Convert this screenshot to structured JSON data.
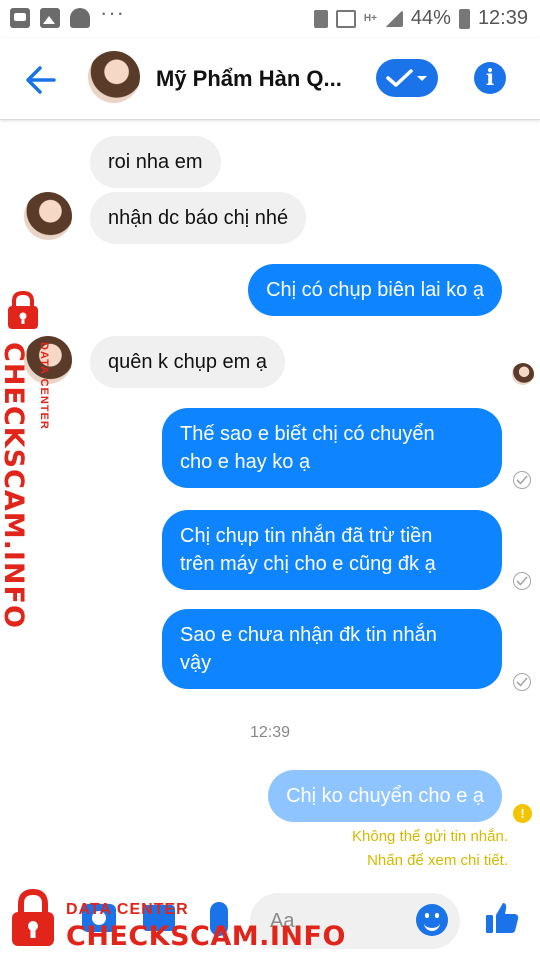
{
  "status_bar": {
    "battery": "44%",
    "time": "12:39",
    "network": "H+",
    "overflow": "···"
  },
  "header": {
    "title": "Mỹ Phẩm Hàn Q...",
    "back_icon": "arrow-left-icon",
    "accent_color": "#1a73e8"
  },
  "messages": [
    {
      "direction": "in",
      "text": "roi nha em"
    },
    {
      "direction": "in",
      "text": "nhận dc báo chị nhé"
    },
    {
      "direction": "out",
      "text": "Chị có chụp biên lai ko ạ"
    },
    {
      "direction": "in",
      "text": "quên k chụp em ạ"
    },
    {
      "direction": "out",
      "lines": [
        "Thế sao e biết chị có chuyển",
        "cho e hay ko ạ"
      ]
    },
    {
      "direction": "out",
      "lines": [
        "Chị chụp tin nhắn đã trừ tiền",
        "trên máy chị cho e cũng đk ạ"
      ]
    },
    {
      "direction": "out",
      "lines": [
        "Sao e chưa nhận đk tin nhắn",
        "vậy"
      ]
    },
    {
      "direction": "out",
      "status": "failed",
      "text": "Chị ko chuyển cho e ạ"
    }
  ],
  "timestamp": "12:39",
  "failure": {
    "line1": "Không thể gửi tin nhắn.",
    "line2": "Nhấn để xem chi tiết.",
    "color": "#d4b800"
  },
  "composer": {
    "placeholder": "Aa"
  },
  "watermark": {
    "small": "DATA CENTER",
    "big": "CHECKSCAM.INFO",
    "color": "#e1251b"
  }
}
